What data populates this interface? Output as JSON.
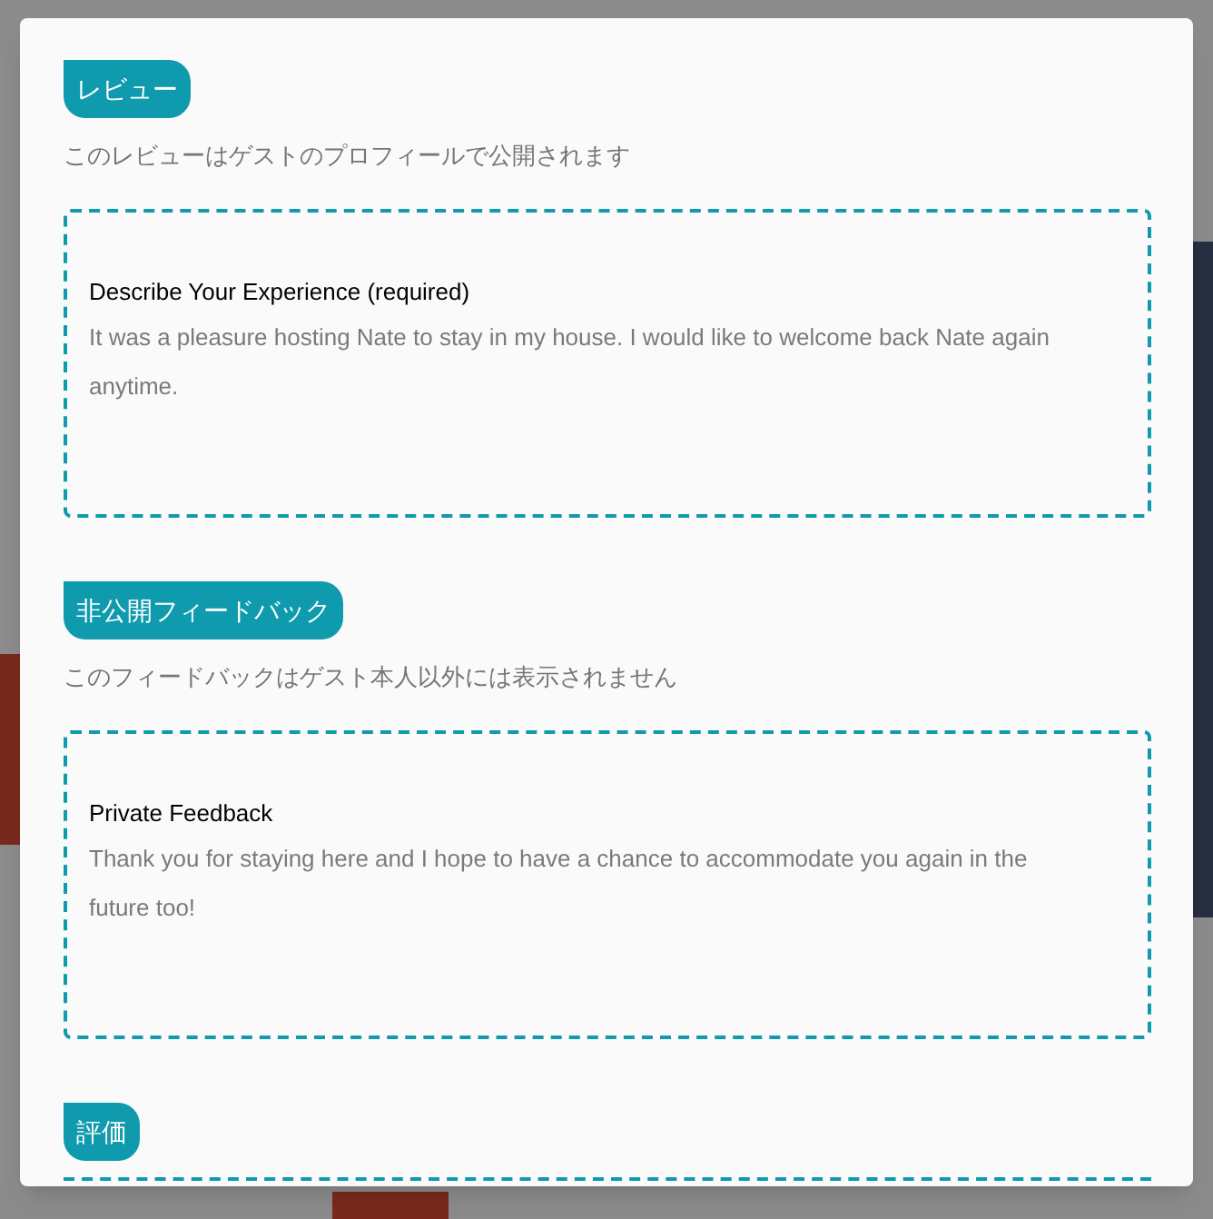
{
  "modal": {
    "sections": [
      {
        "kind": "textbox",
        "badge": "レビュー",
        "note": "このレビューはゲストのプロフィールで公開されます",
        "field_label": "Describe Your Experience (required)",
        "value": "It was a pleasure hosting Nate to stay in my house. I would like to welcome back Nate again anytime."
      },
      {
        "kind": "textbox",
        "badge": "非公開フィードバック",
        "note": "このフィードバックはゲスト本人以外には表示されません",
        "field_label": "Private Feedback",
        "value": "Thank you for staying here and I hope to have a chance to accommodate you again in the future too!"
      },
      {
        "kind": "rating",
        "badge": "評価"
      }
    ]
  }
}
